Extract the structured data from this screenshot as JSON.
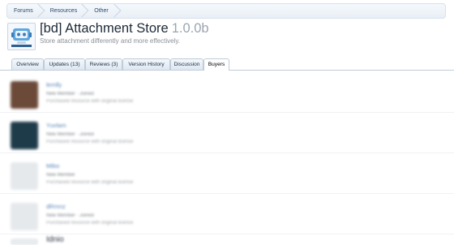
{
  "breadcrumb": [
    "Forums",
    "Resources",
    "Other"
  ],
  "resource": {
    "title": "[bd] Attachment Store",
    "version": "1.0.0b",
    "subtitle": "Store attachment differently and more effectively."
  },
  "tabs": [
    {
      "label": "Overview",
      "active": false
    },
    {
      "label": "Updates (13)",
      "active": false
    },
    {
      "label": "Reviews (3)",
      "active": false
    },
    {
      "label": "Version History",
      "active": false
    },
    {
      "label": "Discussion",
      "active": false
    },
    {
      "label": "Buyers",
      "active": true
    }
  ],
  "buyers": [
    {
      "name": "lemlly",
      "line1": "New Member · Joined",
      "line2": "Purchased resource with original license",
      "avatar_color": "#6b4a3a"
    },
    {
      "name": "Yuvlam",
      "line1": "New Member · Joined",
      "line2": "Purchased resource with original license",
      "avatar_color": "#1e3b4a"
    },
    {
      "name": "Mibo",
      "line1": "New Member",
      "line2": "Purchased resource with original license",
      "avatar_color": "#e6e9ec"
    },
    {
      "name": "dRmnz",
      "line1": "New Member · Joined",
      "line2": "Purchased resource with original license",
      "avatar_color": "#e6e9ec"
    }
  ],
  "bottom_partial": "Idnio"
}
